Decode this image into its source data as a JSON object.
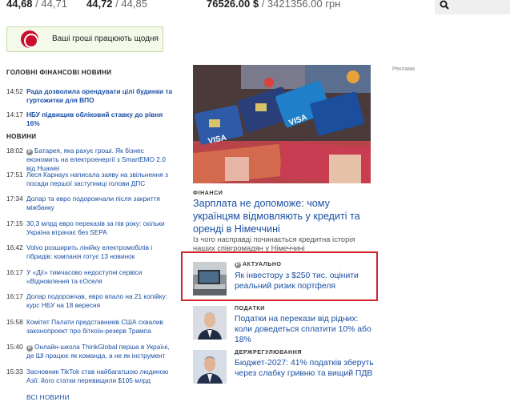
{
  "rates": [
    {
      "main": "44,68",
      "sep": " / ",
      "sec": "44,71"
    },
    {
      "main": "44,72",
      "sep": " / ",
      "sec": "44,85"
    },
    {
      "main": "76526.00 $",
      "sep": " / ",
      "sec": "3421356.00 грн"
    }
  ],
  "search": {
    "icon": "search-icon"
  },
  "promo": {
    "text": "Ваші гроші працюють щодня",
    "icon": "bank-logo-icon"
  },
  "main_news": {
    "title": "ГОЛОВНІ ФІНАНСОВІ НОВИНИ",
    "items": [
      {
        "time": "14:52",
        "text": "Рада дозволила орендувати цілі будинки та гуртожитки для ВПО",
        "bold": true,
        "premium": false
      },
      {
        "time": "14:17",
        "text": "НБУ підвищив обліковий ставку до рівня 16%",
        "bold": true,
        "premium": false
      }
    ]
  },
  "news": {
    "title": "НОВИНИ",
    "items": [
      {
        "time": "18:02",
        "text": "Батарея, яка рахує гроші. Як бізнес економить на електроенергії з SmartEMO 2.0 від Huawei",
        "premium": true
      },
      {
        "time": "17:51",
        "text": "Леся Карнаух написала заяву на звільнення з посади першої заступниці голови ДПС",
        "premium": false
      },
      {
        "time": "17:34",
        "text": "Долар та евро подорожчали після закриття міжбанку",
        "premium": false
      },
      {
        "time": "17:15",
        "text": "30,3 млрд евро переказів за пів року: скільки Україна втрачає без SEPA",
        "premium": false
      },
      {
        "time": "16:42",
        "text": "Volvo розширить лінійку електромобілів і гібридів: компанія готує 13 новинок",
        "premium": false
      },
      {
        "time": "16:17",
        "text": "У «Дії» тимчасово недоступні сервіси «Відновлення та єОселя",
        "premium": false
      },
      {
        "time": "16:17",
        "text": "Долар подорожчав, евро впало на 21 копійку: курс НБУ на 18 вересня",
        "premium": false
      },
      {
        "time": "15:58",
        "text": "Комітет Палати представників США схвалив законопроект про біткоїн-резерв Трампа",
        "premium": false
      },
      {
        "time": "15:40",
        "text": "Онлайн-школа ThinkGlobal перша в Україні, де ШІ працює як команда, а не як інструмент",
        "premium": true
      },
      {
        "time": "15:33",
        "text": "Засновник TikTok став найбагатшою людиною Азії: його статки перевищили $105 млрд",
        "premium": false
      }
    ],
    "all_link": "ВСІ НОВИНИ"
  },
  "ad_label": "Реклама",
  "hero": {
    "category": "ФІНАНСИ",
    "title": "Зарплата не допоможе: чому українцям відмовляють у кредиті та оренді в Німеччині",
    "lead": "Із чого насправді починається кредитна історія наших співгромадян у Німеччині"
  },
  "side_articles": [
    {
      "category": "АКТУАЛЬНО",
      "title": "Як інвестору з $250 тис. оцінити реальний ризик портфеля",
      "premium": true
    },
    {
      "category": "ПОДАТКИ",
      "title": "Податки на перекази від рідних: коли доведеться сплатити 10% або 18%",
      "premium": false
    },
    {
      "category": "ДЕРЖРЕГУЛЮВАННЯ",
      "title": "Бюджет-2027: 41% податків зберуть через слабку гривню та вищий ПДВ",
      "premium": false
    }
  ],
  "premium_badge": "P",
  "colors": {
    "link": "#1a4fa3",
    "highlight": "#d2232a",
    "promo_bg": "#f4f9ea"
  }
}
